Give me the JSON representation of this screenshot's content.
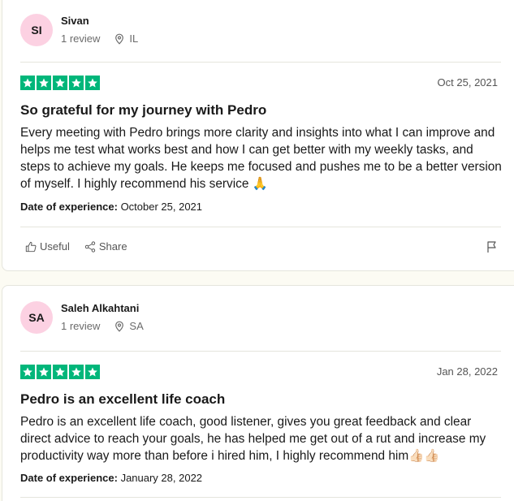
{
  "reviews": [
    {
      "initials": "SI",
      "name": "Sivan",
      "review_count": "1 review",
      "location": "IL",
      "rating": 5,
      "date": "Oct 25, 2021",
      "title": "So grateful for my journey with Pedro",
      "body": "Every meeting with Pedro brings more clarity and insights into what I can improve and helps me test what works best and how I can get better with my weekly tasks, and steps to achieve my goals. He keeps me focused and pushes me to be a better version of myself. I highly recommend his service 🙏",
      "experience_label": "Date of experience:",
      "experience_date": "October 25, 2021",
      "useful_label": "Useful",
      "share_label": "Share"
    },
    {
      "initials": "SA",
      "name": "Saleh Alkahtani",
      "review_count": "1 review",
      "location": "SA",
      "rating": 5,
      "date": "Jan 28, 2022",
      "title": "Pedro is an excellent life coach",
      "body": "Pedro is an excellent life coach, good listener, gives you great feedback and clear direct advice to reach your goals, he has helped me get out of a rut and increase my productivity way more than before i hired him, I highly recommend him👍🏻👍🏻",
      "experience_label": "Date of experience:",
      "experience_date": "January 28, 2022"
    }
  ],
  "colors": {
    "star_green": "#00b67a",
    "avatar_pink": "#fcd1e2",
    "page_bg": "#fcfbf3"
  }
}
